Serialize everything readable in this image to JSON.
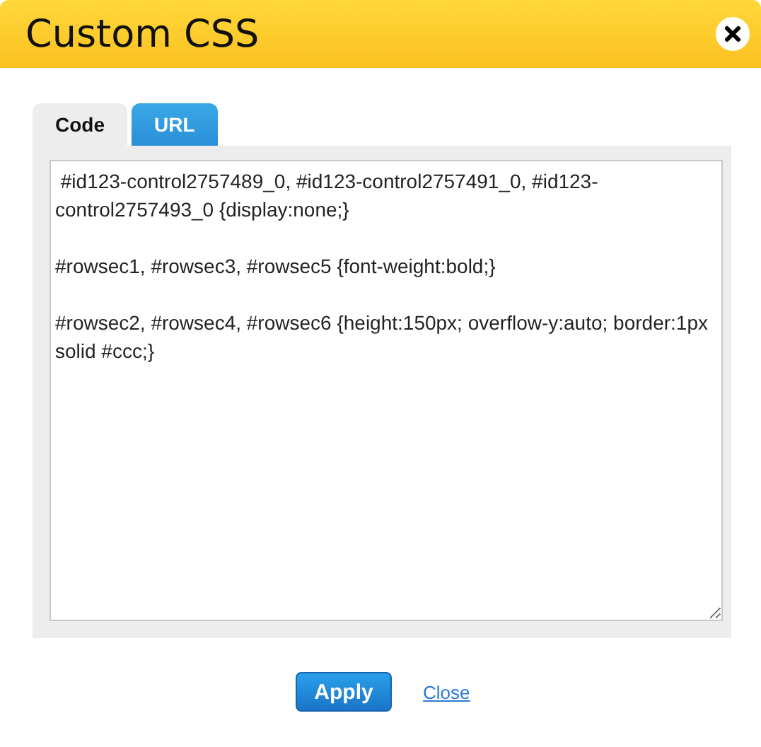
{
  "window": {
    "title": "Custom CSS"
  },
  "tabs": [
    {
      "label": "Code",
      "selected": true
    },
    {
      "label": "URL",
      "selected": false
    }
  ],
  "editor": {
    "value": " #id123-control2757489_0, #id123-control2757491_0, #id123-control2757493_0 {display:none;}\n\n#rowsec1, #rowsec3, #rowsec5 {font-weight:bold;}\n\n#rowsec2, #rowsec4, #rowsec6 {height:150px; overflow-y:auto; border:1px solid #ccc;}"
  },
  "buttons": {
    "apply": "Apply",
    "close": "Close"
  }
}
